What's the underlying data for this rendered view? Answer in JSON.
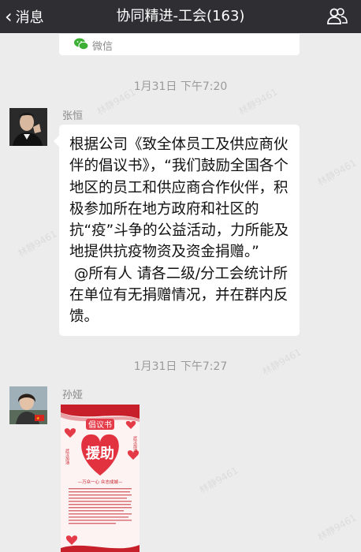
{
  "nav": {
    "back_label": "消息",
    "title": "协同精进-工会(163)"
  },
  "prev_card": {
    "source": "微信"
  },
  "messages": [
    {
      "timestamp": "1月31日 下午7:20",
      "sender": "张恒",
      "text": "根据公司《致全体员工及供应商伙伴的倡议书》，“我们鼓励全国各个地区的员工和供应商合作伙伴，积极参加所在地方政府和社区的抗“疫”斗争的公益活动，力所能及地提供抗疫物资及资金捐赠。”\n @所有人 请各二级/分工会统计所在单位有无捐赠情况，并在群内反馈。"
    },
    {
      "timestamp": "1月31日 下午7:27",
      "sender": "孙娅",
      "image": {
        "title": "倡议书",
        "heart_text": "援助",
        "slogan": "—万众一心 众志成城—",
        "side_left": "武汉加油",
        "side_right": "武汉加油"
      }
    }
  ],
  "watermark": "林静9461",
  "colors": {
    "navbar": "#2e2e33",
    "background": "#ececec",
    "bubble": "#ffffff",
    "poster_red": "#e02a2a"
  }
}
